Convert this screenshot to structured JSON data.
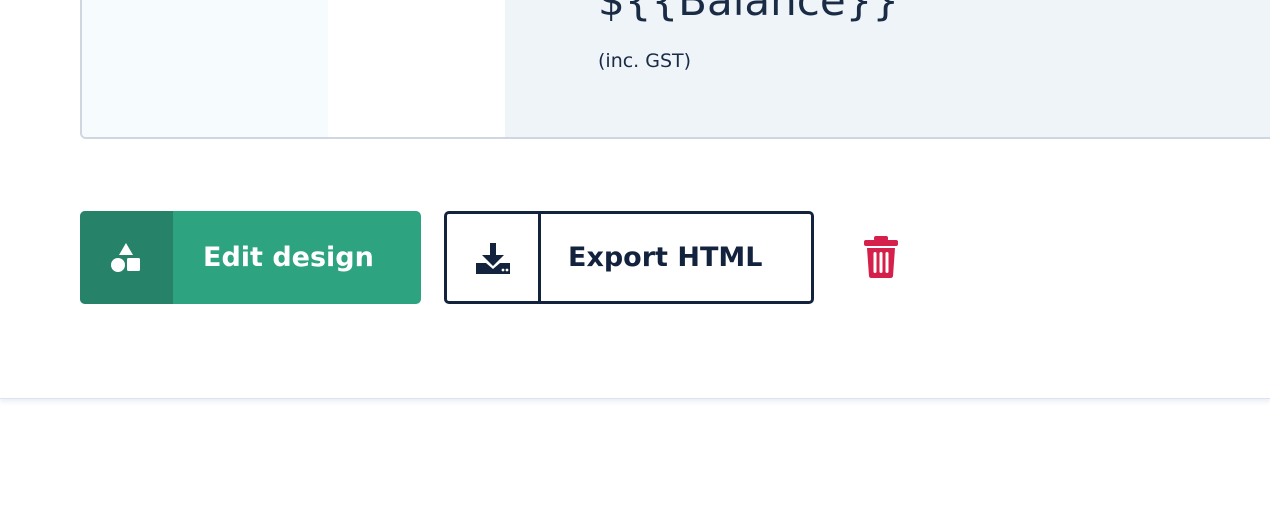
{
  "preview": {
    "balance_value": "${{Balance}}",
    "balance_note": "(inc. GST)"
  },
  "actions": {
    "edit_design_label": "Edit design",
    "edit_design_icon": "shapes-icon",
    "export_html_label": "Export HTML",
    "export_html_icon": "download-icon",
    "delete_icon": "trash-icon"
  },
  "colors": {
    "edit_button": "#2da380",
    "edit_button_icon_bg": "#26836a",
    "export_border": "#13233d",
    "delete": "#d4204a",
    "text_dark": "#1a2b45"
  }
}
